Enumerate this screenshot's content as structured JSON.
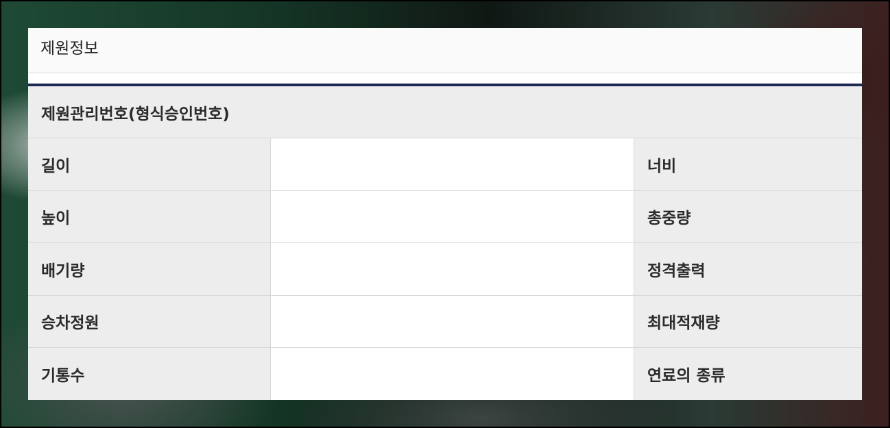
{
  "panel": {
    "title": "제원정보"
  },
  "spec_table": {
    "management_number_label": "제원관리번호(형식승인번호)",
    "rows": [
      {
        "left_label": "길이",
        "left_value": "",
        "right_label": "너비"
      },
      {
        "left_label": "높이",
        "left_value": "",
        "right_label": "총중량"
      },
      {
        "left_label": "배기량",
        "left_value": "",
        "right_label": "정격출력"
      },
      {
        "left_label": "승차정원",
        "left_value": "",
        "right_label": "최대적재량"
      },
      {
        "left_label": "기통수",
        "left_value": "",
        "right_label": "연료의 종류"
      }
    ]
  },
  "colors": {
    "header_rule": "#1d2951",
    "label_cell_bg": "#ededed",
    "value_cell_bg": "#ffffff"
  }
}
